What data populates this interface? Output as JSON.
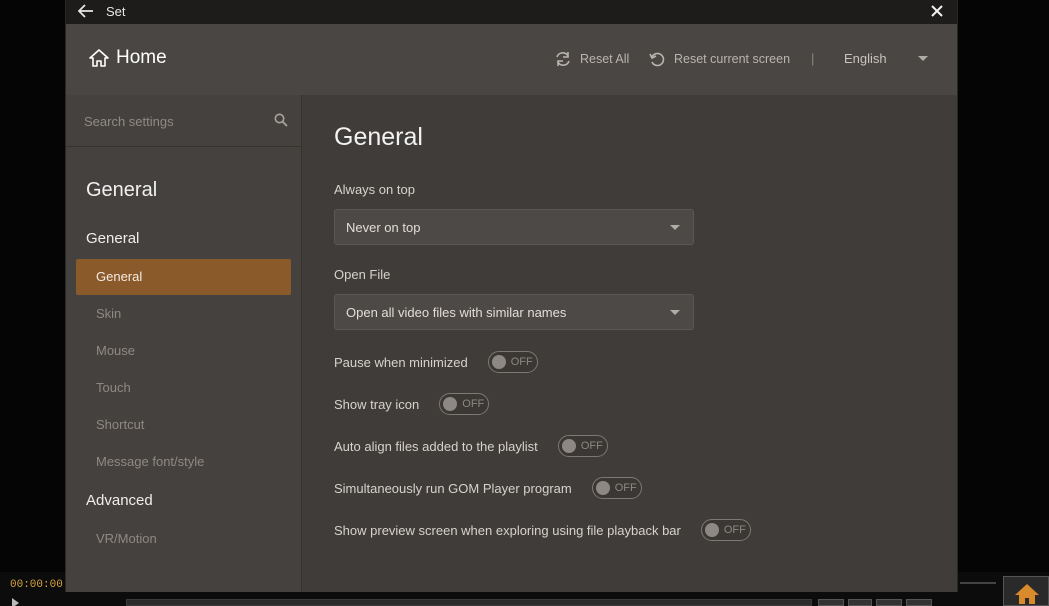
{
  "window": {
    "title": "Set"
  },
  "header": {
    "home_label": "Home",
    "reset_all_label": "Reset All",
    "reset_current_label": "Reset current screen",
    "separator": "|",
    "language": "English"
  },
  "sidebar": {
    "search_placeholder": "Search settings",
    "heading": "General",
    "groups": [
      {
        "label": "General",
        "items": [
          "General",
          "Skin",
          "Mouse",
          "Touch",
          "Shortcut",
          "Message font/style"
        ]
      },
      {
        "label": "Advanced",
        "items": [
          "VR/Motion"
        ]
      }
    ],
    "active_item": "General"
  },
  "content": {
    "title": "General",
    "always_on_top": {
      "label": "Always on top",
      "value": "Never on top"
    },
    "open_file": {
      "label": "Open File",
      "value": "Open all video files with similar names"
    },
    "toggles": [
      {
        "label": "Pause when minimized",
        "state": "OFF"
      },
      {
        "label": "Show tray icon",
        "state": "OFF"
      },
      {
        "label": "Auto align files added to the playlist",
        "state": "OFF"
      },
      {
        "label": "Simultaneously run GOM Player program",
        "state": "OFF"
      },
      {
        "label": "Show preview screen when exploring using file playback bar",
        "state": "OFF"
      }
    ]
  },
  "player": {
    "time": "00:00:00"
  },
  "colors": {
    "accent": "#8a5a2b",
    "time_color": "#d9a441"
  }
}
